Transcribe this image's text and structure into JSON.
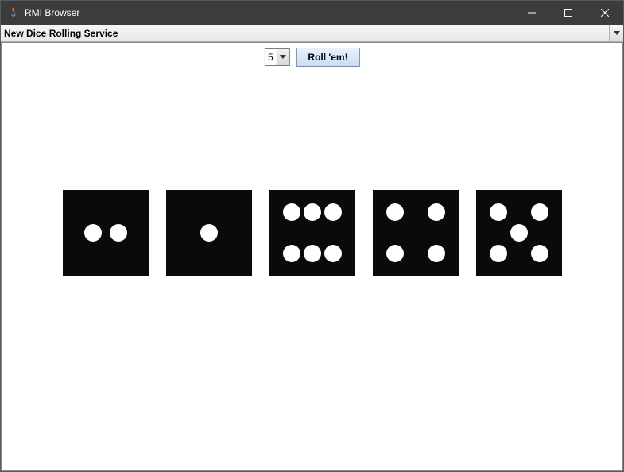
{
  "window": {
    "title": "RMI Browser"
  },
  "combo": {
    "selected": "New Dice Rolling Service"
  },
  "toolbar": {
    "dice_count": "5",
    "roll_label": "Roll 'em!"
  },
  "dice": {
    "values": [
      2,
      1,
      6,
      4,
      5
    ]
  },
  "colors": {
    "titlebar_bg": "#3c3c3c",
    "die_bg": "#0a0a0a",
    "pip": "#ffffff"
  }
}
